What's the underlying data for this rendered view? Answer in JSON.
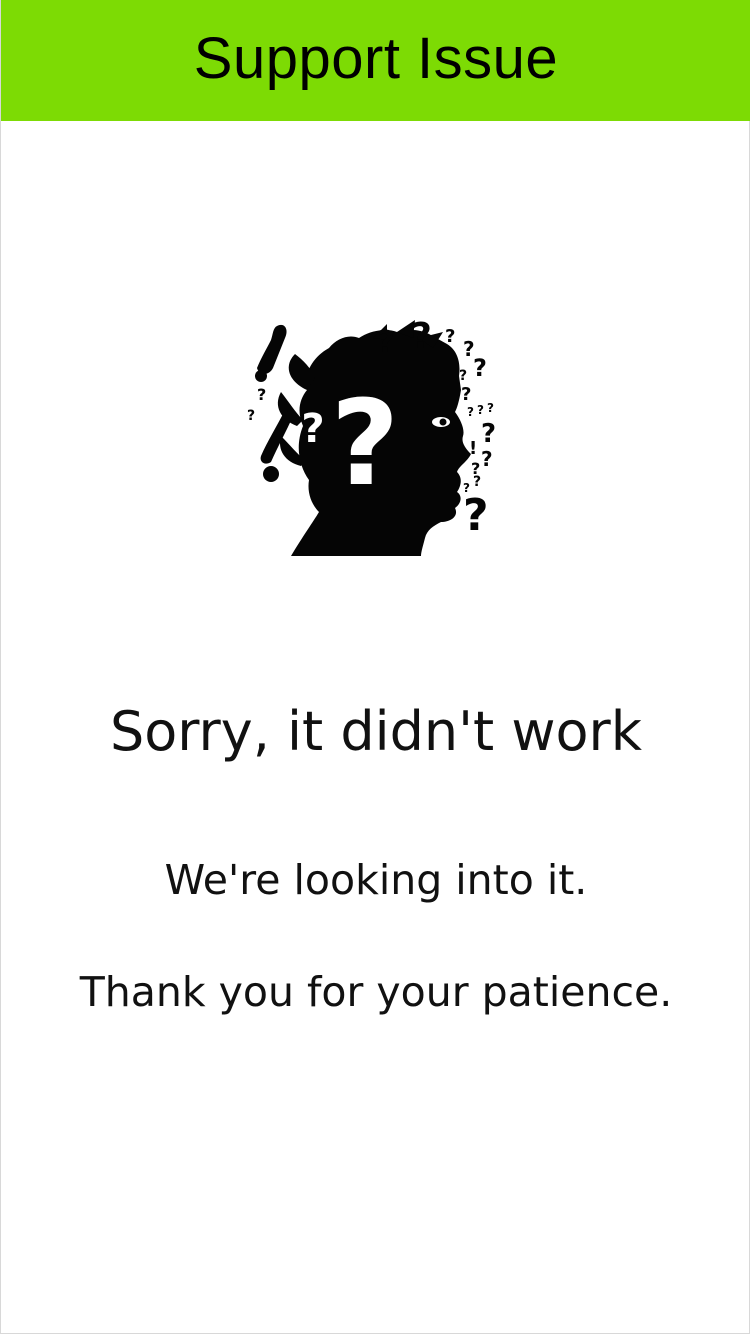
{
  "header": {
    "title": "Support Issue",
    "background_color": "#7ddb04"
  },
  "illustration": {
    "icon": "confused-head-question-marks-icon"
  },
  "message": {
    "title": "Sorry, it didn't work",
    "line1": "We're looking into it.",
    "line2": "Thank you for your patience."
  }
}
